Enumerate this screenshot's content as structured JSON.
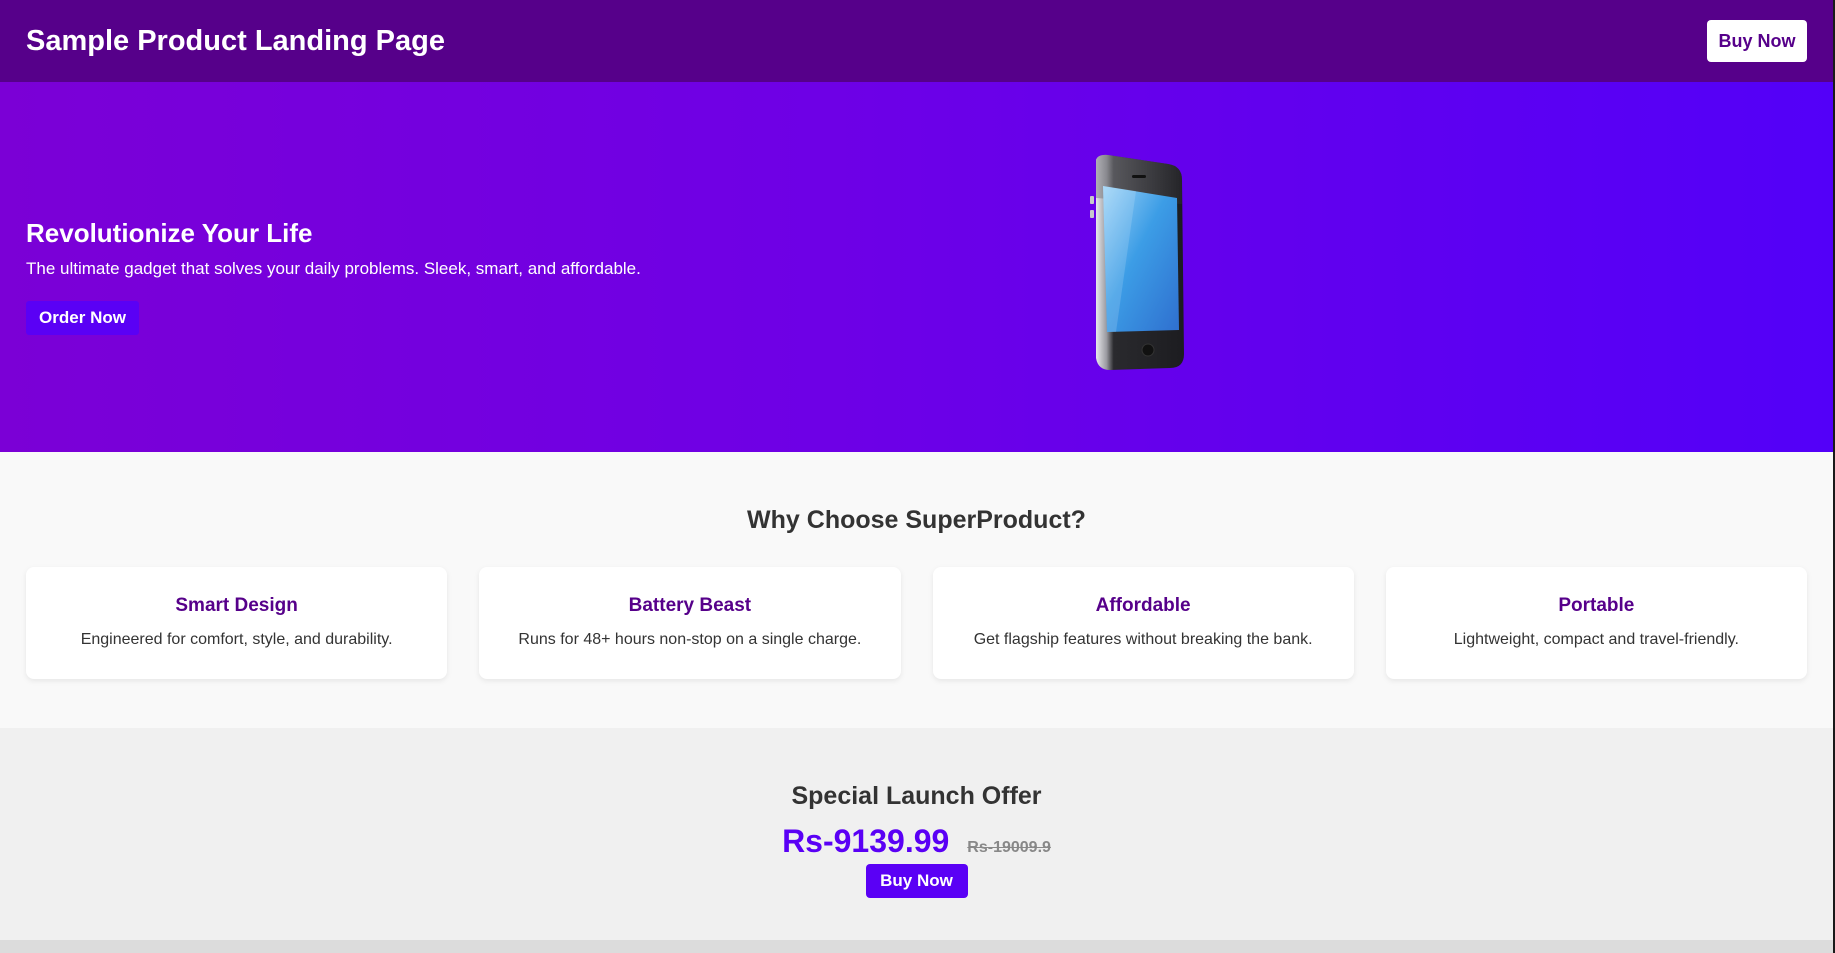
{
  "header": {
    "title": "Sample Product Landing Page",
    "buy_label": "Buy Now"
  },
  "hero": {
    "title": "Revolutionize Your Life",
    "subtitle": "The ultimate gadget that solves your daily problems. Sleek, smart, and affordable.",
    "order_label": "Order Now",
    "image_icon": "smartphone-icon"
  },
  "features": {
    "title": "Why Choose SuperProduct?",
    "items": [
      {
        "title": "Smart Design",
        "desc": "Engineered for comfort, style, and durability."
      },
      {
        "title": "Battery Beast",
        "desc": "Runs for 48+ hours non-stop on a single charge."
      },
      {
        "title": "Affordable",
        "desc": "Get flagship features without breaking the bank."
      },
      {
        "title": "Portable",
        "desc": "Lightweight, compact and travel-friendly."
      }
    ]
  },
  "offer": {
    "title": "Special Launch Offer",
    "price": "Rs-9139.99",
    "old_price": "Rs-19009.9",
    "buy_label": "Buy Now"
  },
  "colors": {
    "header_bg": "#56008a",
    "accent": "#5a00f5",
    "hero_gradient_start": "#7b00d6",
    "hero_gradient_end": "#5300f8"
  }
}
